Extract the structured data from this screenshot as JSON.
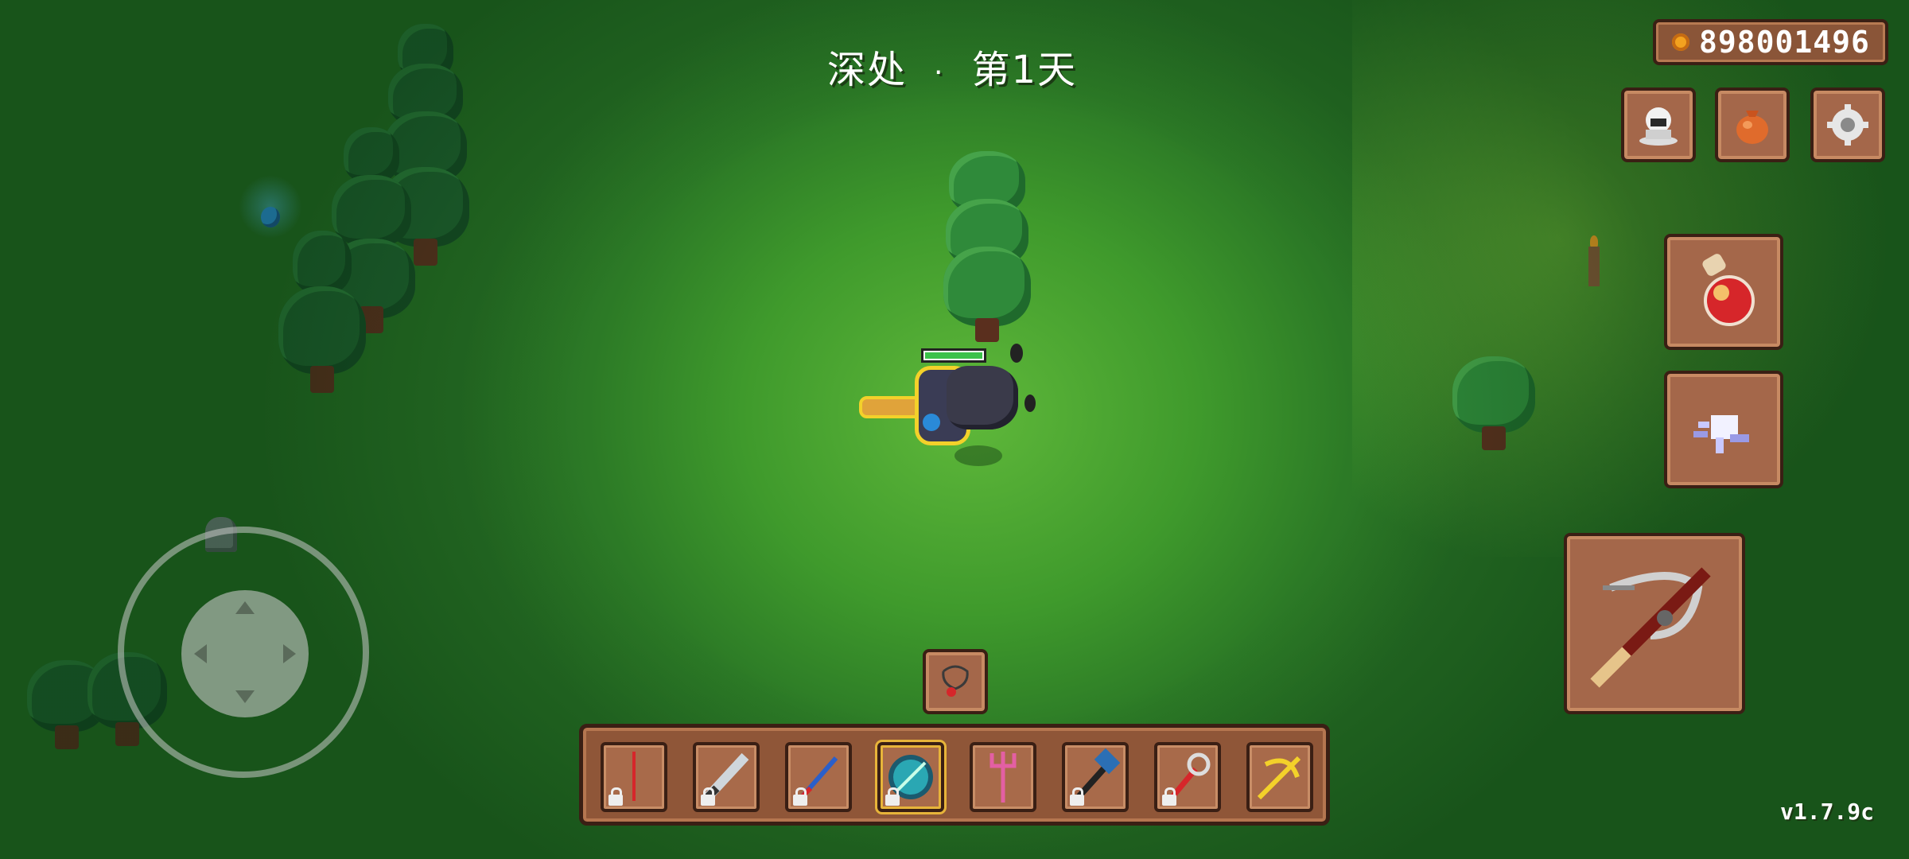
{
  "hud": {
    "location": "深处",
    "separator": "·",
    "day": "第1天",
    "coins": "898001496",
    "version": "v1.7.9c"
  },
  "top_buttons": [
    {
      "name": "ghost-icon"
    },
    {
      "name": "bag-icon"
    },
    {
      "name": "gear-icon"
    }
  ],
  "side_actions": [
    {
      "name": "potion-icon"
    },
    {
      "name": "dash-icon"
    },
    {
      "name": "crossbow-icon"
    }
  ],
  "hotbar": {
    "slots": [
      {
        "icon": "staff-icon",
        "locked": true,
        "selected": false
      },
      {
        "icon": "sword-icon",
        "locked": true,
        "selected": false
      },
      {
        "icon": "blade-icon",
        "locked": true,
        "selected": false
      },
      {
        "icon": "orb-icon",
        "locked": true,
        "selected": true
      },
      {
        "icon": "trident-icon",
        "locked": false,
        "selected": false
      },
      {
        "icon": "hammer-icon",
        "locked": true,
        "selected": false
      },
      {
        "icon": "wand-icon",
        "locked": true,
        "selected": false
      },
      {
        "icon": "bow-icon",
        "locked": false,
        "selected": false
      }
    ],
    "accessory": "amulet-icon"
  },
  "colors": {
    "panel": "#a4674a",
    "panel_border": "#3a1f14",
    "grass": "#3f9a2c"
  }
}
